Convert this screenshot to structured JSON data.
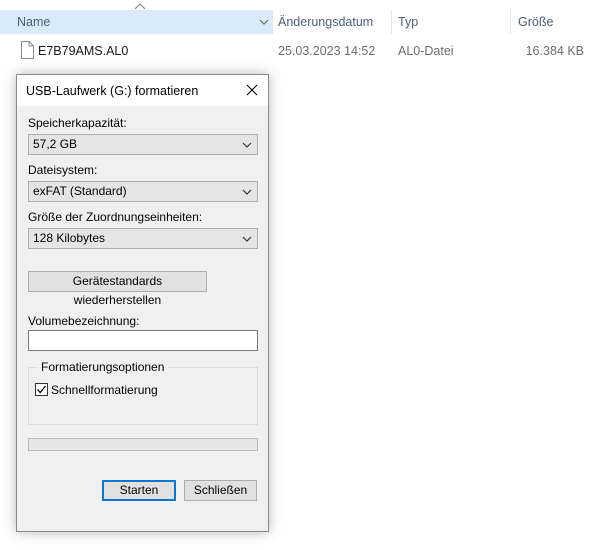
{
  "explorer": {
    "columns": {
      "name": "Name",
      "date": "Änderungsdatum",
      "type": "Typ",
      "size": "Größe"
    },
    "files": [
      {
        "name": "E7B79AMS.AL0",
        "date": "25.03.2023 14:52",
        "type": "AL0-Datei",
        "size": "16.384 KB"
      }
    ]
  },
  "dialog": {
    "title": "USB-Laufwerk (G:) formatieren",
    "capacity_label": "Speicherkapazität:",
    "capacity_value": "57,2 GB",
    "filesystem_label": "Dateisystem:",
    "filesystem_value": "exFAT (Standard)",
    "allocation_label": "Größe der Zuordnungseinheiten:",
    "allocation_value": "128 Kilobytes",
    "restore_defaults_label": "Gerätestandards wiederherstellen",
    "volume_label": "Volumebezeichnung:",
    "volume_value": "",
    "options_group_title": "Formatierungsoptionen",
    "quick_format_label": "Schnellformatierung",
    "quick_format_checked": true,
    "progress": 0,
    "start_label": "Starten",
    "close_label": "Schließen"
  },
  "colors": {
    "header_selected": "#dbeaf8",
    "dialog_background": "#f0f0f0",
    "accent_border": "#0078d7"
  }
}
